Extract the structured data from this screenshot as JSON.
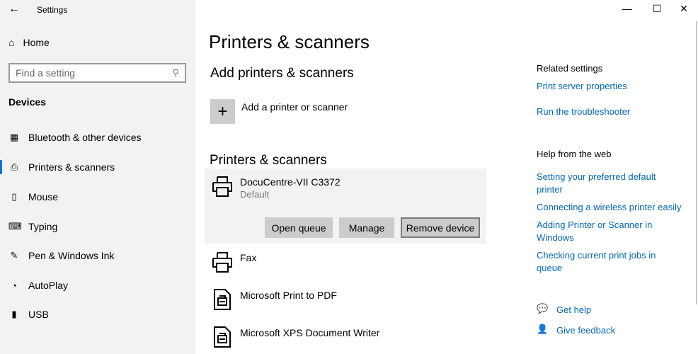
{
  "window": {
    "title": "Settings",
    "minimize": "—",
    "maximize": "☐",
    "close": "✕"
  },
  "sidebar": {
    "home": "Home",
    "search_placeholder": "Find a setting",
    "section": "Devices",
    "items": [
      {
        "label": "Bluetooth & other devices",
        "icon": "bluetooth-devices-icon"
      },
      {
        "label": "Printers & scanners",
        "icon": "printer-icon",
        "selected": true
      },
      {
        "label": "Mouse",
        "icon": "mouse-icon"
      },
      {
        "label": "Typing",
        "icon": "keyboard-icon"
      },
      {
        "label": "Pen & Windows Ink",
        "icon": "pen-icon"
      },
      {
        "label": "AutoPlay",
        "icon": "autoplay-icon"
      },
      {
        "label": "USB",
        "icon": "usb-icon"
      }
    ]
  },
  "main": {
    "title": "Printers & scanners",
    "add_heading": "Add printers & scanners",
    "add_label": "Add a printer or scanner",
    "list_heading": "Printers & scanners",
    "printers": [
      {
        "name": "DocuCentre-VII C3372",
        "status": "Default"
      },
      {
        "name": "Fax"
      },
      {
        "name": "Microsoft Print to PDF"
      },
      {
        "name": "Microsoft XPS Document Writer"
      }
    ],
    "buttons": {
      "open_queue": "Open queue",
      "manage": "Manage",
      "remove": "Remove device"
    }
  },
  "related": {
    "heading": "Related settings",
    "links": [
      "Print server properties",
      "Run the troubleshooter"
    ],
    "web_heading": "Help from the web",
    "web_links": [
      "Setting your preferred default printer",
      "Connecting a wireless printer easily",
      "Adding Printer or Scanner in Windows",
      "Checking current print jobs in queue"
    ],
    "get_help": "Get help",
    "feedback": "Give feedback"
  },
  "colors": {
    "accent": "#0078d7",
    "link": "#0067b8",
    "sidebar_bg": "#f2f2f2"
  }
}
